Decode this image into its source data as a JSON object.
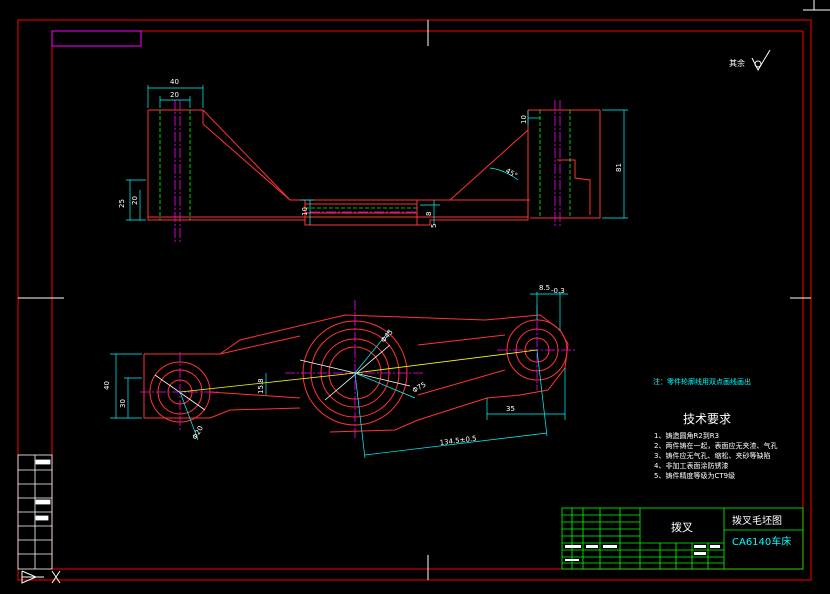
{
  "drawing": {
    "surface_symbol": {
      "label": "其余"
    },
    "dimensions": {
      "top_width_outer": "40",
      "top_width_inner": "20",
      "left_height_small": "20",
      "left_height_big": "25",
      "center_thickness": "10",
      "right_top": "10",
      "right_angle": "45°",
      "right_height": "81",
      "center_small_a": "8",
      "center_small_b": "5",
      "right_tol": "8.5",
      "right_tol_sub": "-0.3",
      "bottom_left_height": "40",
      "bottom_left_small": "30",
      "center_hole": "15.8",
      "dia_large": "Φ45",
      "dia_hub": "Φ75",
      "dia_left": "Φ20",
      "right_span": "35",
      "center_distance": "134.5±0.5"
    },
    "note": "注：零件轮廓线用双点画线画出",
    "tech_title": "技术要求",
    "tech_items": [
      "1、铸造圆角R2到R3",
      "2、两件铸在一起，表面应无夹渣、气孔",
      "3、铸件应无气孔、缩松、夹砂等缺陷",
      "4、非加工表面涂防锈漆",
      "5、铸件精度等级为CT9级"
    ],
    "title_block": {
      "part_name": "拨叉",
      "drawing_name": "拨叉毛坯图",
      "machine": "CA6140车床"
    }
  },
  "colors": {
    "background": "#000000",
    "border": "#ff0000",
    "outline": "#ff3333",
    "dimension": "#00ffff",
    "centerline": "#ff00ff",
    "hidden": "#00ff00",
    "highlight": "#ffff00",
    "title_block": "#00ff00"
  }
}
